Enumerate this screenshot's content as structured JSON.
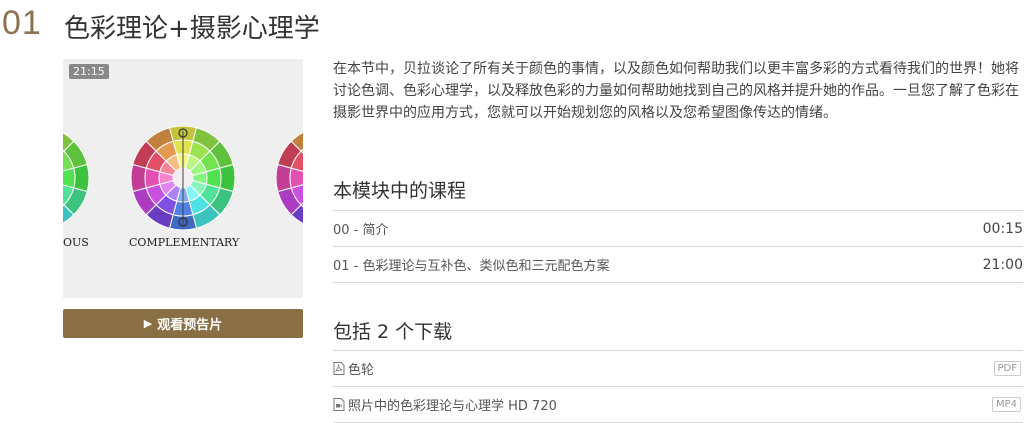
{
  "module": {
    "number": "01",
    "title": "色彩理论+摄影心理学",
    "description": "在本节中，贝拉谈论了所有关于颜色的事情，以及颜色如何帮助我们以更丰富多彩的方式看待我们的世界！她将讨论色调、色彩心理学，以及释放色彩的力量如何帮助她找到自己的风格并提升她的作品。一旦您了解了色彩在摄影世界中的应用方式，您就可以开始规划您的风格以及您希望图像传达的情绪。"
  },
  "thumbnail": {
    "duration": "21:15",
    "left_label": "OUS",
    "center_label": "COMPLEMENTARY",
    "icon": "color-wheel-icon"
  },
  "preview_button": {
    "label": "观看预告片",
    "icon": "play-icon"
  },
  "lessons": {
    "heading": "本模块中的课程",
    "items": [
      {
        "title": "00 - 简介",
        "duration": "00:15"
      },
      {
        "title": "01 - 色彩理论与互补色、类似色和三元配色方案",
        "duration": "21:00"
      }
    ]
  },
  "downloads": {
    "heading": "包括 2 个下载",
    "items": [
      {
        "title": "色轮",
        "type": "PDF",
        "icon": "pdf-file-icon"
      },
      {
        "title": "照片中的色彩理论与心理学 HD 720",
        "type": "MP4",
        "icon": "video-file-icon"
      }
    ]
  },
  "colors": {
    "accent": "#8a6f45",
    "module_number": "#8a7350",
    "thumbnail_bg": "#efefef"
  }
}
